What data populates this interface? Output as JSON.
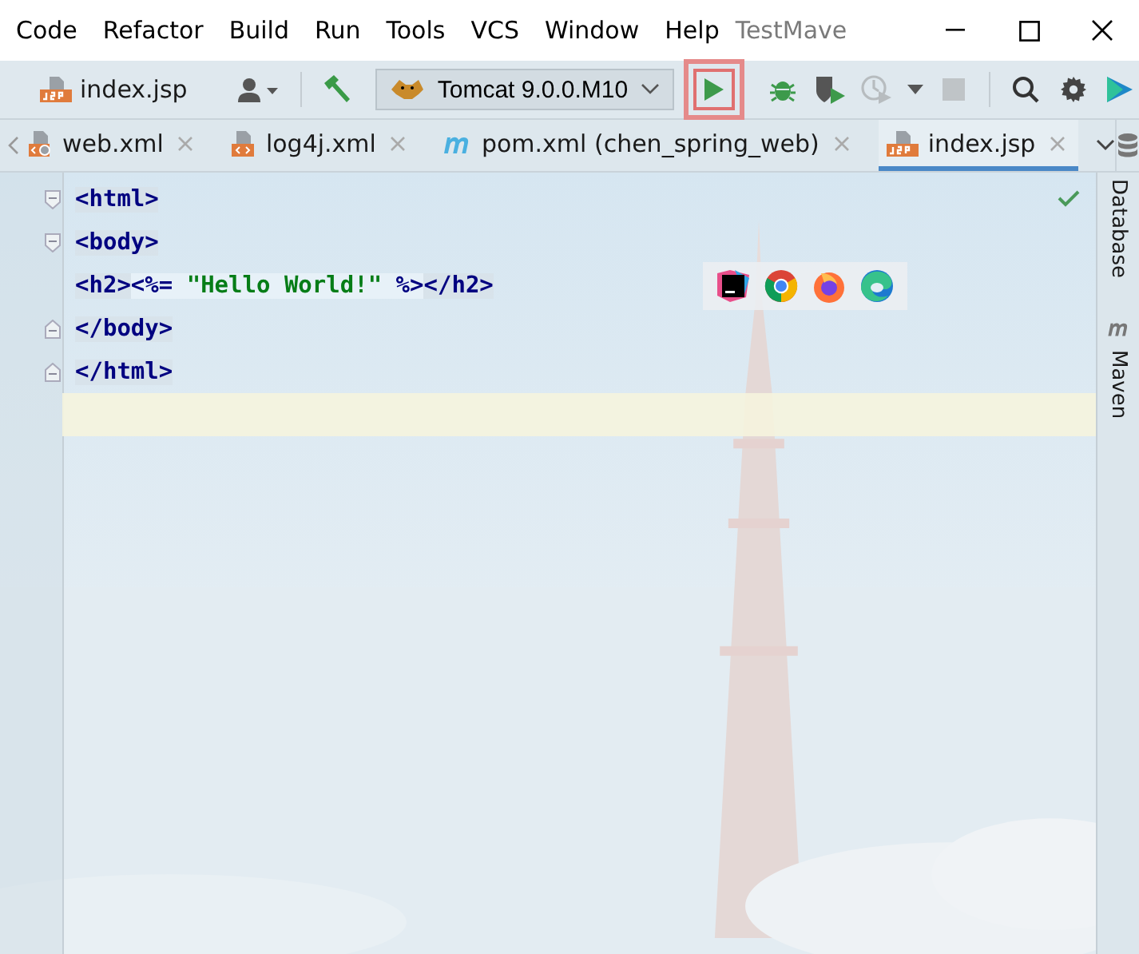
{
  "menu": [
    {
      "label": "Code"
    },
    {
      "label": "Refactor"
    },
    {
      "label": "Build"
    },
    {
      "label": "Run"
    },
    {
      "label": "Tools"
    },
    {
      "label": "VCS"
    },
    {
      "label": "Window"
    },
    {
      "label": "Help"
    }
  ],
  "window": {
    "title": "TestMave"
  },
  "toolbar": {
    "breadcrumb": "index.jsp",
    "run_config": "Tomcat 9.0.0.M10",
    "buttons": [
      {
        "kind": "run",
        "disabled": false,
        "highlighted": true
      },
      {
        "kind": "debug",
        "disabled": false,
        "highlighted": false
      },
      {
        "kind": "coverage",
        "disabled": false,
        "highlighted": false
      },
      {
        "kind": "profile",
        "disabled": true,
        "highlighted": false
      },
      {
        "kind": "caret",
        "disabled": false,
        "highlighted": false
      },
      {
        "kind": "stop",
        "disabled": true,
        "highlighted": false
      }
    ]
  },
  "tabs": [
    {
      "label": "web.xml",
      "kind": "webxml",
      "selected": false
    },
    {
      "label": "log4j.xml",
      "kind": "xml",
      "selected": false
    },
    {
      "label": "pom.xml (chen_spring_web)",
      "kind": "maven",
      "selected": false
    },
    {
      "label": "index.jsp",
      "kind": "jsp",
      "selected": true
    }
  ],
  "editor": {
    "lines": [
      {
        "current": false,
        "tokens": [
          {
            "kind": "tag",
            "text": "<html>"
          }
        ]
      },
      {
        "current": false,
        "tokens": [
          {
            "kind": "tag",
            "text": "<body>"
          }
        ]
      },
      {
        "current": false,
        "tokens": [
          {
            "kind": "tag",
            "text": "<h2>"
          },
          {
            "kind": "jsp",
            "text": "<%= "
          },
          {
            "kind": "string",
            "text": "\"Hello World!\""
          },
          {
            "kind": "jsp",
            "text": " %>"
          },
          {
            "kind": "tag",
            "text": "</h2>"
          }
        ]
      },
      {
        "current": false,
        "tokens": [
          {
            "kind": "tag",
            "text": "</body>"
          }
        ]
      },
      {
        "current": false,
        "tokens": [
          {
            "kind": "tag",
            "text": "</html>"
          }
        ]
      },
      {
        "current": true
      }
    ]
  },
  "sidebar": [
    {
      "label": "Database",
      "kind": "database"
    },
    {
      "label": "Maven",
      "kind": "maven"
    }
  ]
}
